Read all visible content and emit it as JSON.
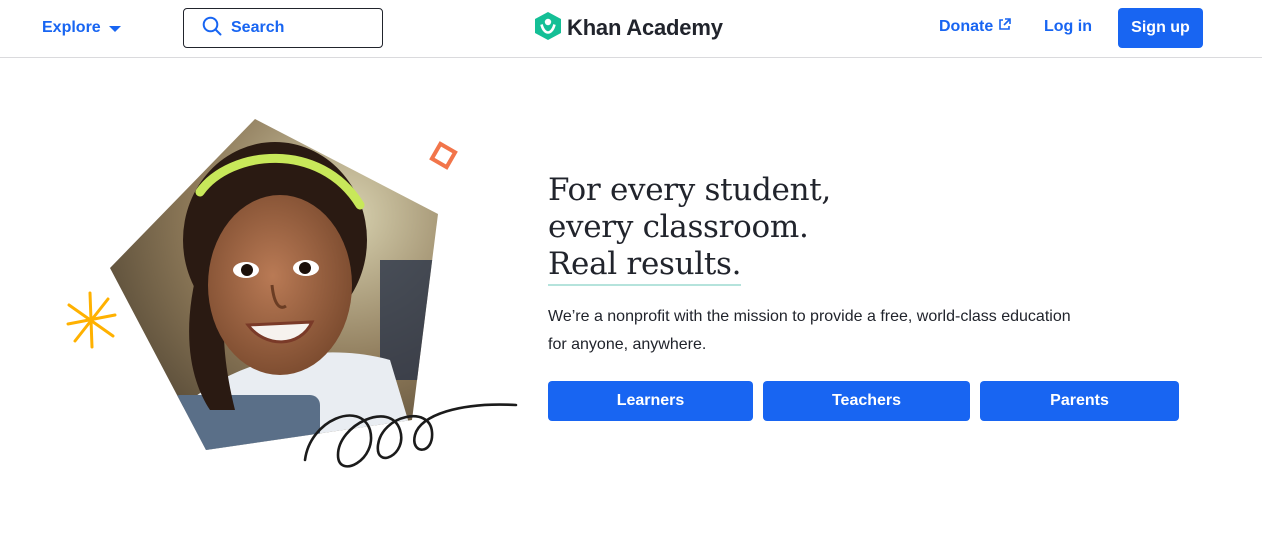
{
  "header": {
    "explore_label": "Explore",
    "search_label": "Search",
    "logo_text": "Khan Academy",
    "donate_label": "Donate",
    "login_label": "Log in",
    "signup_label": "Sign up"
  },
  "hero": {
    "headline_line1": "For every student,",
    "headline_line2": "every classroom.",
    "headline_line3": "Real results.",
    "subtitle_line1": "We’re a nonprofit with the mission to provide a free, world-class education",
    "subtitle_line2": "for anyone, anywhere.",
    "buttons": [
      {
        "label": "Learners"
      },
      {
        "label": "Teachers"
      },
      {
        "label": "Parents"
      }
    ]
  },
  "colors": {
    "brand_blue": "#1865f2",
    "logo_green": "#14bf96",
    "text": "#21242c",
    "accent_orange": "#f2754a",
    "accent_yellow": "#ffb100",
    "underline_teal": "#b5e3dc"
  },
  "icons": {
    "explore_caret": "chevron-down-icon",
    "search": "search-icon",
    "logo": "khan-academy-logo",
    "donate": "external-link-icon"
  }
}
